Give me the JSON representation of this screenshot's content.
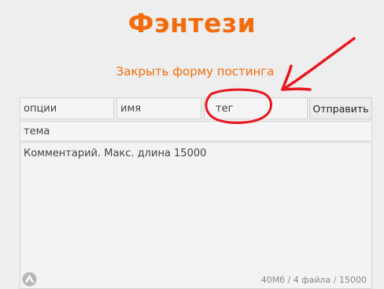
{
  "board": {
    "title": "Фэнтези"
  },
  "form": {
    "close_label": "Закрыть форму постинга",
    "options_placeholder": "опции",
    "name_placeholder": "имя",
    "tag_placeholder": "тег",
    "submit_label": "Отправить",
    "subject_placeholder": "тема",
    "comment_placeholder": "Комментарий. Макс. длина 15000",
    "limits_text": "40Мб / 4 файла / 15000"
  },
  "icons": {
    "upload": "upload-triangle-icon"
  },
  "colors": {
    "accent": "#f26c0d",
    "annotation": "#e8161e",
    "background": "#eeeeee"
  }
}
